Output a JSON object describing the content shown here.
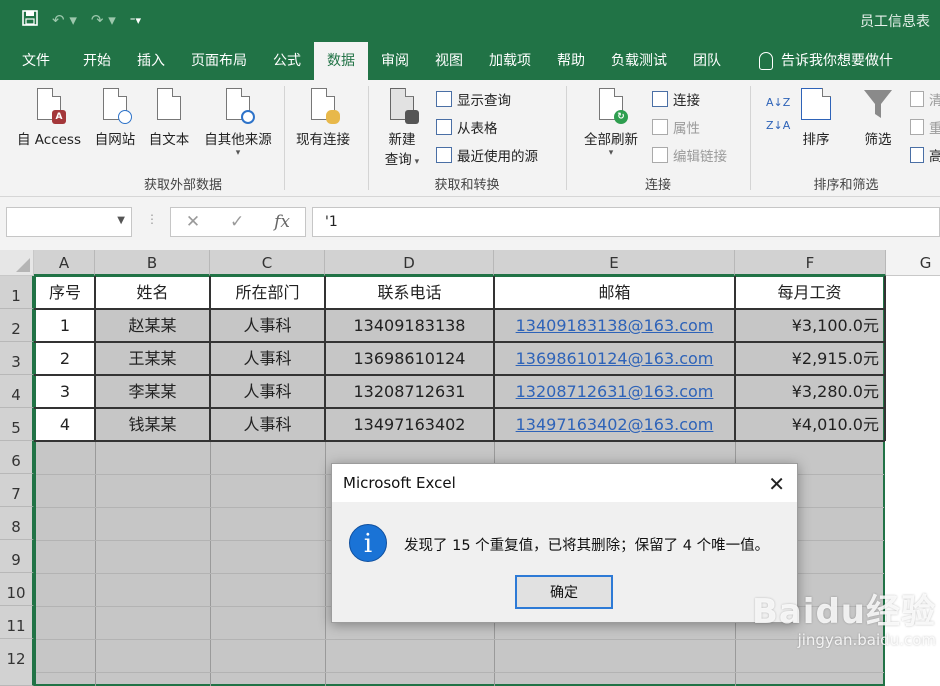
{
  "window": {
    "title": "员工信息表"
  },
  "qat": {
    "save": "save-icon",
    "undo": "undo-icon",
    "redo": "redo-icon",
    "customize": "customize-icon"
  },
  "tabs": [
    "文件",
    "开始",
    "插入",
    "页面布局",
    "公式",
    "数据",
    "审阅",
    "视图",
    "加载项",
    "帮助",
    "负载测试",
    "团队"
  ],
  "active_tab": "数据",
  "tell_me": "告诉我你想要做什",
  "ribbon": {
    "external": {
      "label": "获取外部数据",
      "access": "自 Access",
      "web": "自网站",
      "text": "自文本",
      "other1": "自其他来源",
      "existing": "现有连接"
    },
    "transform": {
      "label": "获取和转换",
      "new_query_1": "新建",
      "new_query_2": "查询",
      "show_queries": "显示查询",
      "from_table": "从表格",
      "recent_sources": "最近使用的源"
    },
    "connections": {
      "label": "连接",
      "refresh_all": "全部刷新",
      "connections": "连接",
      "properties": "属性",
      "edit_links": "编辑链接"
    },
    "sort_filter": {
      "label": "排序和筛选",
      "sort": "排序",
      "filter": "筛选",
      "clear": "清",
      "reapply": "重",
      "advanced": "高"
    }
  },
  "formula_bar": {
    "name_box": "",
    "content": "'1",
    "fx": "fx"
  },
  "columns": [
    {
      "letter": "A",
      "header": "序号"
    },
    {
      "letter": "B",
      "header": "姓名"
    },
    {
      "letter": "C",
      "header": "所在部门"
    },
    {
      "letter": "D",
      "header": "联系电话"
    },
    {
      "letter": "E",
      "header": "邮箱"
    },
    {
      "letter": "F",
      "header": "每月工资"
    },
    {
      "letter": "G",
      "header": ""
    }
  ],
  "rows": [
    {
      "id": "1",
      "name": "赵某某",
      "dept": "人事科",
      "phone": "13409183138",
      "email": "13409183138@163.com",
      "salary": "¥3,100.0元"
    },
    {
      "id": "2",
      "name": "王某某",
      "dept": "人事科",
      "phone": "13698610124",
      "email": "13698610124@163.com",
      "salary": "¥2,915.0元"
    },
    {
      "id": "3",
      "name": "李某某",
      "dept": "人事科",
      "phone": "13208712631",
      "email": "13208712631@163.com",
      "salary": "¥3,280.0元"
    },
    {
      "id": "4",
      "name": "钱某某",
      "dept": "人事科",
      "phone": "13497163402",
      "email": "13497163402@163.com",
      "salary": "¥4,010.0元"
    }
  ],
  "row_numbers": [
    "1",
    "2",
    "3",
    "4",
    "5",
    "6",
    "7",
    "8",
    "9",
    "10",
    "11",
    "12"
  ],
  "dialog": {
    "title": "Microsoft Excel",
    "message": "发现了 15 个重复值，已将其删除；保留了 4 个唯一值。",
    "ok": "确定",
    "icon": "info-icon"
  },
  "watermark": {
    "logo": "Baidu经验",
    "url": "jingyan.baidu.com"
  },
  "colors": {
    "excel_green": "#217346",
    "link": "#2e63b8",
    "selection": "#c6c6c6"
  }
}
